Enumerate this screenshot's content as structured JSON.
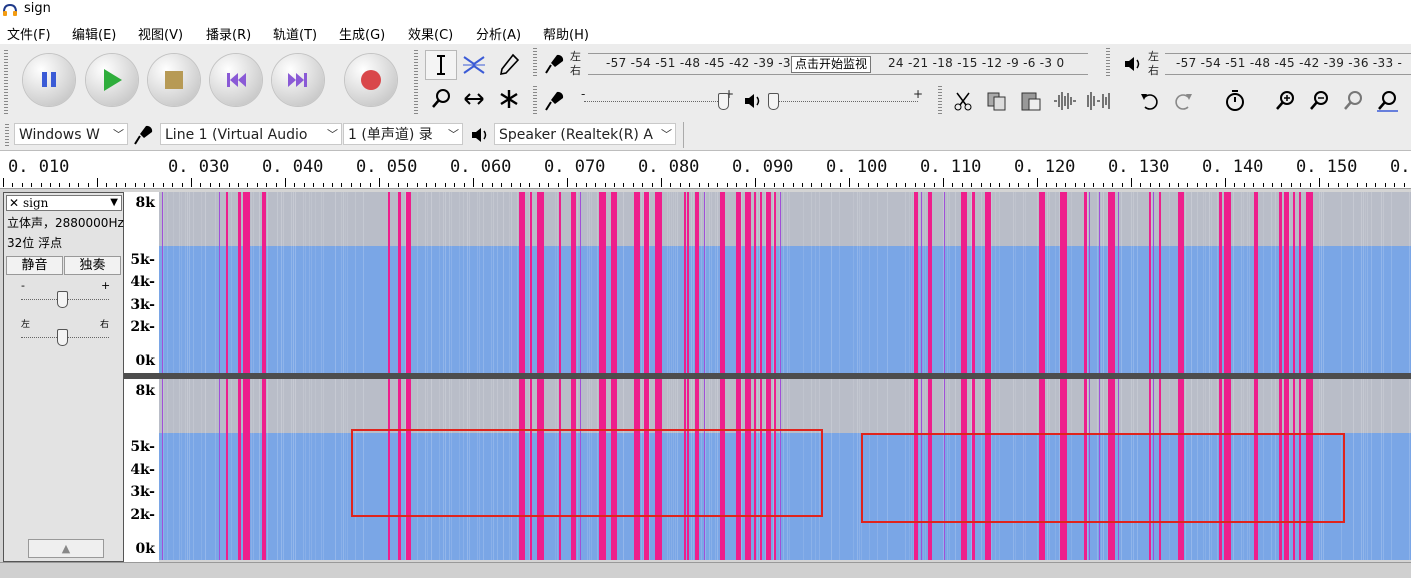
{
  "window": {
    "title": "sign"
  },
  "menu": [
    "文件(F)",
    "编辑(E)",
    "视图(V)",
    "播录(R)",
    "轨道(T)",
    "生成(G)",
    "效果(C)",
    "分析(A)",
    "帮助(H)"
  ],
  "recording_meter": {
    "left": "左",
    "right": "右",
    "scale": "-57 -54 -51 -48 -45 -42 -39 -3",
    "scale_rest": "24 -21 -18 -15 -12  -9  -6  -3  0",
    "monitor_tip": "点击开始监视"
  },
  "playback_meter": {
    "left": "左",
    "right": "右",
    "scale": "-57 -54 -51 -48 -45 -42 -39 -36 -33 -"
  },
  "slider_marks": {
    "minus": "-",
    "plus": "+"
  },
  "devices": {
    "host": "Windows W",
    "input": "Line 1 (Virtual Audio",
    "channels": "1 (单声道) 录",
    "output": "Speaker (Realtek(R) A"
  },
  "ruler": {
    "labels": [
      "0. 010",
      "0. 030",
      "0. 040",
      "0. 050",
      "0. 060",
      "0. 070",
      "0. 080",
      "0. 090",
      "0. 100",
      "0. 110",
      "0. 120",
      "0. 130",
      "0. 140",
      "0. 150",
      "0."
    ]
  },
  "track": {
    "close": "✕",
    "name": "sign",
    "info1": "立体声，2880000Hz",
    "info2": "32位 浮点",
    "mute": "静音",
    "solo": "独奏",
    "gain_minus": "-",
    "gain_plus": "+",
    "pan_left": "左",
    "pan_right": "右"
  },
  "spectrum_scale": {
    "top": [
      "8k",
      "5k-",
      "4k-",
      "3k-",
      "2k-",
      "0k"
    ],
    "bottom": [
      "8k",
      "5k-",
      "4k-",
      "3k-",
      "2k-",
      "0k"
    ]
  },
  "colors": {
    "spectrum_blue": "#7aa6e6",
    "spectrum_gray": "#b9bdc8",
    "spectrum_pink": "#ee1f8c",
    "selection_red": "#e0241c"
  }
}
